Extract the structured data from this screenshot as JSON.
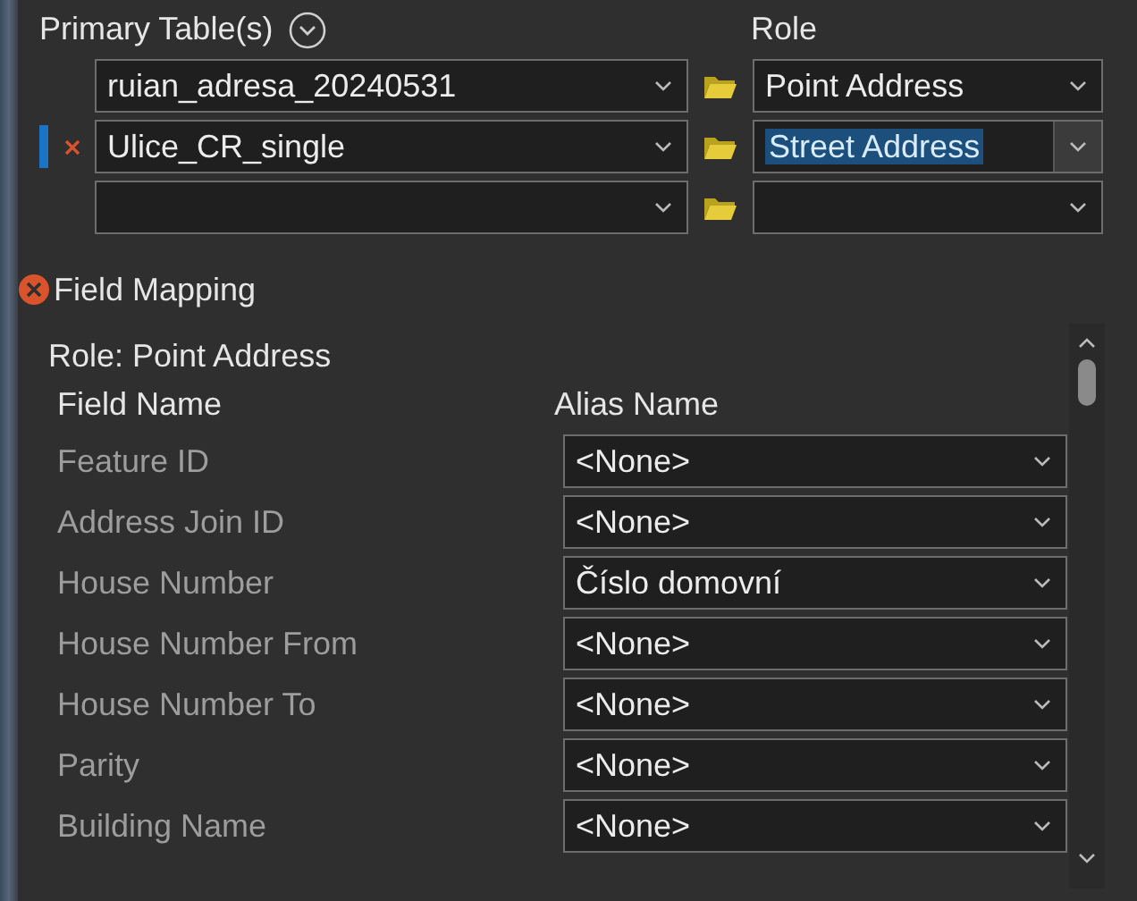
{
  "header": {
    "primary_label": "Primary Table(s)",
    "role_label": "Role"
  },
  "tables": [
    {
      "table": "ruian_adresa_20240531",
      "role": "Point Address",
      "selected": false,
      "error": false
    },
    {
      "table": "Ulice_CR_single",
      "role": "Street Address",
      "selected": true,
      "error": true
    },
    {
      "selected": false,
      "error": false
    }
  ],
  "field_mapping": {
    "title": "Field Mapping",
    "error": true,
    "role_title": "Role: Point Address",
    "columns": [
      "Field Name",
      "Alias Name"
    ],
    "rows": [
      {
        "field": "Feature ID",
        "alias": "<None>"
      },
      {
        "field": "Address Join ID",
        "alias": "<None>"
      },
      {
        "field": "House Number",
        "alias": "Číslo domovní"
      },
      {
        "field": "House Number From",
        "alias": "<None>"
      },
      {
        "field": "House Number To",
        "alias": "<None>"
      },
      {
        "field": "Parity",
        "alias": "<None>"
      },
      {
        "field": "Building Name",
        "alias": "<None>"
      }
    ]
  }
}
